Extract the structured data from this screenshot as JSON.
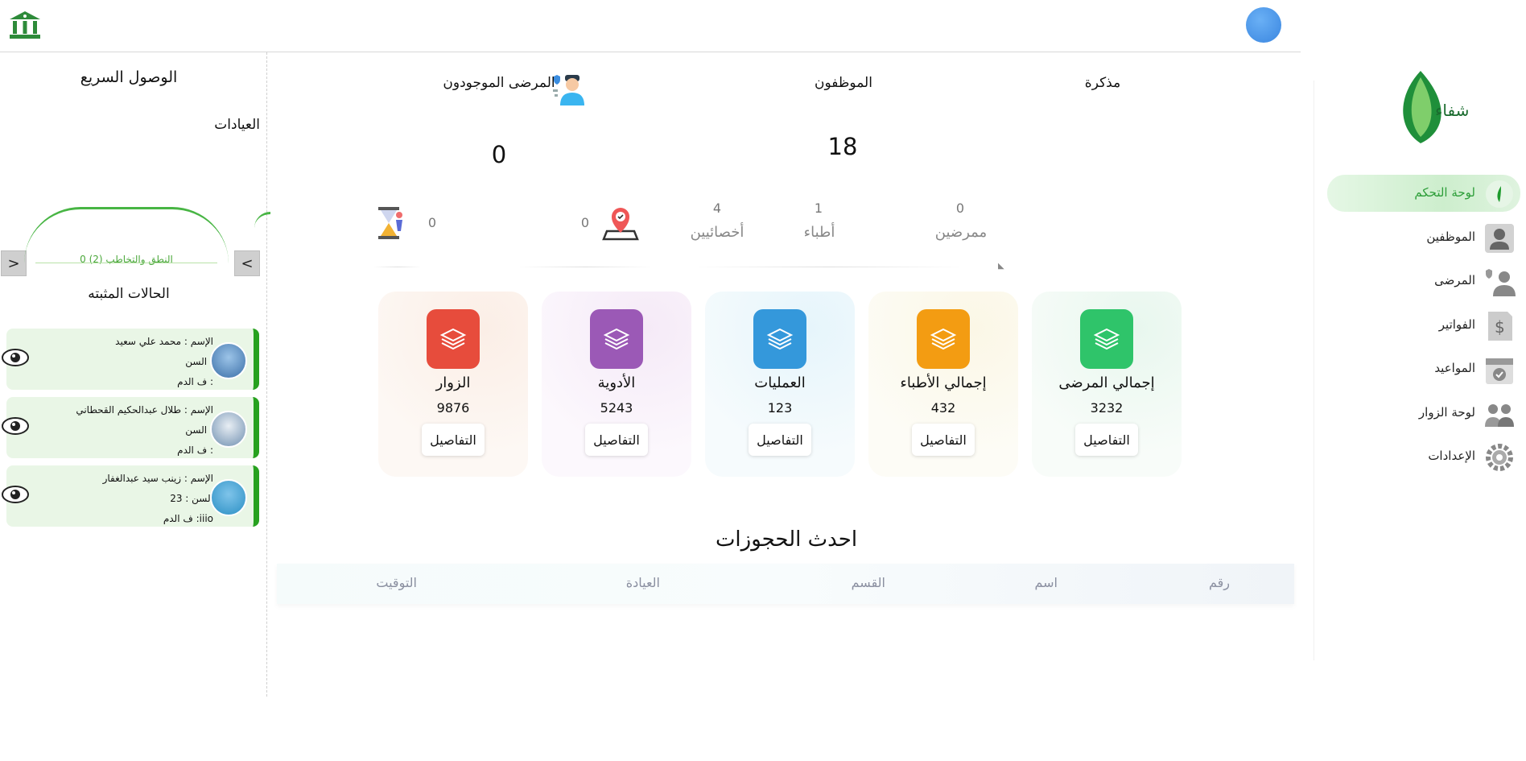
{
  "quick_access": {
    "title": "الوصول السريع",
    "clinics_label": "العيادات",
    "prev_arrow": "<",
    "next_arrow": ">",
    "clinic_name": "النطق والتخاطب (2) 0",
    "pinned_title": "الحالات المثبته",
    "pinned": [
      {
        "name": "الإسم : محمد علي سعيد",
        "age": "السن :",
        "blood": "ف الدم :"
      },
      {
        "name": "الإسم : طلال عبدالحكيم القحطاني",
        "age": "السن :",
        "blood": "ف الدم :"
      },
      {
        "name": "الإسم : زينب سيد عبدالغفار",
        "age": "السن : 23",
        "blood": "ف الدم :iiio"
      }
    ]
  },
  "stats": {
    "present_patients_label": "المرضى الموجودون",
    "present_patients_value": "0",
    "staff_label": "الموظفون",
    "staff_value": "18",
    "memo_label": "مذكرة",
    "nurses_num": "0",
    "nurses_label": "ممرضين",
    "doctors_num": "1",
    "doctors_label": "أطباء",
    "specialists_num": "4",
    "specialists_label": "أخصائيين",
    "location_num": "0",
    "waiting_num": "0"
  },
  "kpis": [
    {
      "title": "إجمالي المرضى",
      "value": "3232",
      "button": "التفاصيل",
      "color": "#2fc46a"
    },
    {
      "title": "إجمالي الأطباء",
      "value": "432",
      "button": "التفاصيل",
      "color": "#f39c12"
    },
    {
      "title": "العمليات",
      "value": "123",
      "button": "التفاصيل",
      "color": "#3498db"
    },
    {
      "title": "الأدوية",
      "value": "5243",
      "button": "التفاصيل",
      "color": "#9b59b6"
    },
    {
      "title": "الزوار",
      "value": "9876",
      "button": "التفاصيل",
      "color": "#e74c3c"
    }
  ],
  "bookings": {
    "title": "احدث الحجوزات",
    "columns": [
      "رقم",
      "اسم",
      "القسم",
      "العيادة",
      "التوقيت"
    ]
  },
  "sidebar": {
    "logo_text": "شفاء",
    "items": [
      {
        "label": "لوحة التحكم",
        "icon": "dashboard-icon"
      },
      {
        "label": "الموظفين",
        "icon": "staff-icon"
      },
      {
        "label": "المرضى",
        "icon": "patients-icon"
      },
      {
        "label": "الفواتير",
        "icon": "invoices-icon"
      },
      {
        "label": "المواعيد",
        "icon": "appointments-icon"
      },
      {
        "label": "لوحة الزوار",
        "icon": "visitors-icon"
      },
      {
        "label": "الإعدادات",
        "icon": "settings-icon"
      }
    ]
  },
  "colors": {
    "accent": "#27a11f",
    "nav_active_bg": "#cdeecd"
  }
}
